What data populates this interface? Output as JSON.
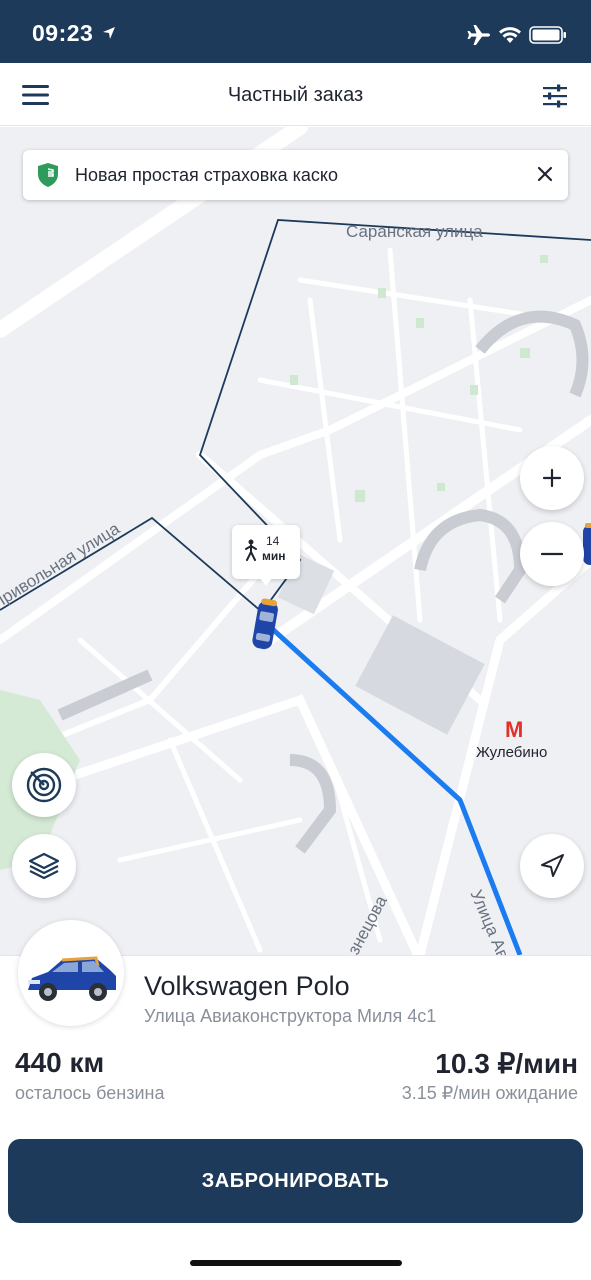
{
  "status": {
    "time": "09:23"
  },
  "header": {
    "title": "Частный заказ",
    "menu_icon": "hamburger-icon",
    "filter_icon": "sliders-icon"
  },
  "banner": {
    "text": "Новая простая страховка каско",
    "icon": "shield-icon"
  },
  "map": {
    "streets": [
      "Саранская улица",
      "Привольная улица",
      "Улица Ав",
      "знецова"
    ],
    "metro": {
      "letter": "М",
      "name": "Жулебино"
    },
    "walk": {
      "time": "14",
      "unit": "мин"
    },
    "route_color": "#1a7cf0"
  },
  "car": {
    "name": "Volkswagen Polo",
    "address": "Улица Авиаконструктора Миля 4с1",
    "fuel_value": "440 км",
    "fuel_label": "осталось бензина",
    "price_value": "10.3 ₽/мин",
    "price_label": "3.15 ₽/мин ожидание"
  },
  "actions": {
    "book_label": "ЗАБРОНИРОВАТЬ"
  },
  "colors": {
    "brand": "#1d3a5a",
    "accent": "#1a7cf0",
    "metro": "#e2312b"
  }
}
